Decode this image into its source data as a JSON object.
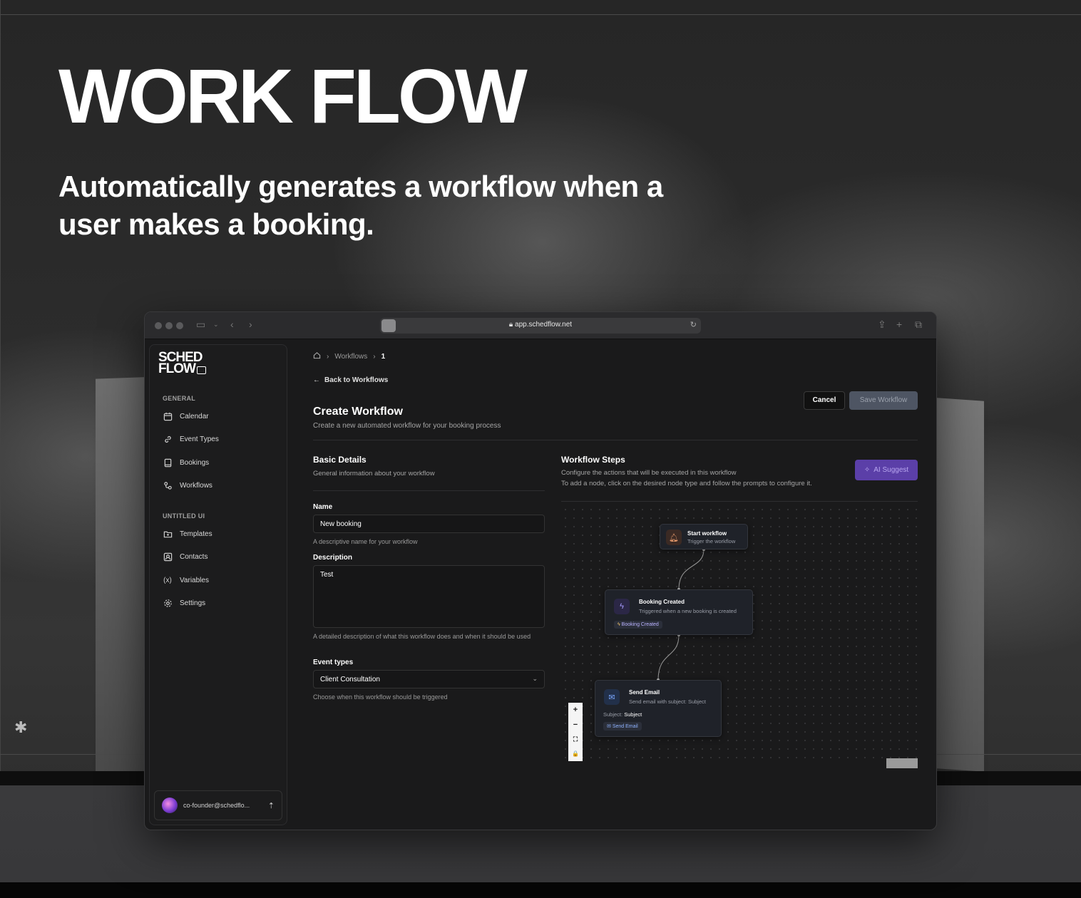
{
  "hero": {
    "title": "WORK FLOW",
    "subtitle": "Automatically generates a workflow when a user makes a booking."
  },
  "browser": {
    "url": "app.schedflow.net"
  },
  "sidebar": {
    "logo_line1": "SCHED",
    "logo_line2": "FLOW",
    "sections": [
      {
        "label": "GENERAL",
        "items": [
          {
            "label": "Calendar",
            "icon": "calendar-icon"
          },
          {
            "label": "Event Types",
            "icon": "link-icon"
          },
          {
            "label": "Bookings",
            "icon": "book-icon"
          },
          {
            "label": "Workflows",
            "icon": "workflow-icon"
          }
        ]
      },
      {
        "label": "UNTITLED UI",
        "items": [
          {
            "label": "Templates",
            "icon": "folder-icon"
          },
          {
            "label": "Contacts",
            "icon": "contact-icon"
          },
          {
            "label": "Variables",
            "icon": "variable-icon"
          },
          {
            "label": "Settings",
            "icon": "gear-icon"
          }
        ]
      }
    ],
    "user_email": "co-founder@schedflo..."
  },
  "breadcrumb": {
    "items": [
      "Workflows",
      "1"
    ]
  },
  "header": {
    "back_label": "Back to Workflows",
    "title": "Create Workflow",
    "subtitle": "Create a new automated workflow for your booking process",
    "cancel_label": "Cancel",
    "save_label": "Save Workflow"
  },
  "basic_details": {
    "title": "Basic Details",
    "subtitle": "General information about your workflow",
    "name_label": "Name",
    "name_value": "New booking",
    "name_help": "A descriptive name for your workflow",
    "description_label": "Description",
    "description_value": "Test",
    "description_help": "A detailed description of what this workflow does and when it should be used",
    "event_types_label": "Event types",
    "event_types_value": "Client Consultation",
    "event_types_help": "Choose when this workflow should be triggered"
  },
  "workflow_steps": {
    "title": "Workflow Steps",
    "subtitle_1": "Configure the actions that will be executed in this workflow",
    "subtitle_2": "To add a node, click on the desired node type and follow the prompts to configure it.",
    "ai_button": "AI Suggest",
    "nodes": {
      "start": {
        "title": "Start workflow",
        "sub": "Trigger the workflow"
      },
      "booking": {
        "title": "Booking Created",
        "sub": "Triggered when a new booking is created",
        "tag": "Booking Created"
      },
      "email": {
        "title": "Send Email",
        "sub": "Send email with subject: Subject",
        "subject_label": "Subject:",
        "subject_value": "Subject",
        "tag": "Send Email"
      }
    },
    "zoom_controls": [
      "+",
      "−",
      "⛶",
      "🔒"
    ]
  },
  "colors": {
    "accent_purple": "#5b3fa8",
    "save_button": "#4e5563",
    "background": "#1a1a1b"
  }
}
